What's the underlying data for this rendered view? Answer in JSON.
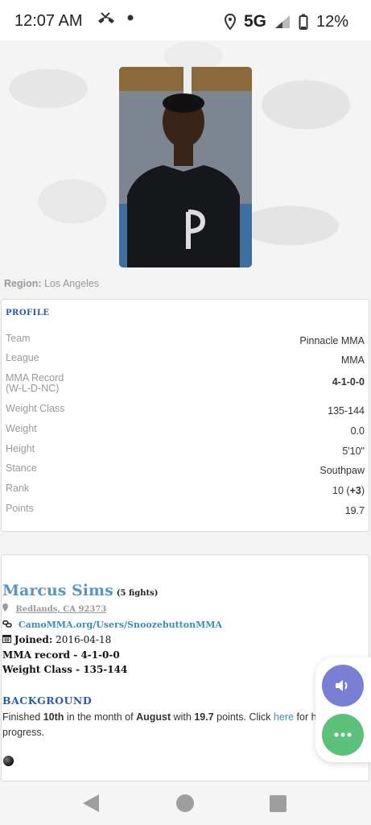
{
  "status_bar": {
    "time": "12:07 AM",
    "network": "5G",
    "battery": "12%",
    "icons": [
      "missed-call-icon",
      "dot-icon",
      "location-icon",
      "signal-icon",
      "battery-icon"
    ]
  },
  "region": {
    "label": "Region:",
    "value": "Los Angeles"
  },
  "profile": {
    "title": "PROFILE",
    "rows": [
      {
        "label": "Team",
        "value": "Pinnacle MMA"
      },
      {
        "label": "League",
        "value": "MMA"
      },
      {
        "label": "MMA Record",
        "sublabel": "(W-L-D-NC)",
        "value": "4-1-0-0"
      },
      {
        "label": "Weight Class",
        "value": "135-144"
      },
      {
        "label": "Weight",
        "value": "0.0"
      },
      {
        "label": "Height",
        "value": "5'10\""
      },
      {
        "label": "Stance",
        "value": "Southpaw"
      },
      {
        "label": "Rank",
        "value": "10",
        "change": "+3"
      },
      {
        "label": "Points",
        "value": "19.7"
      }
    ]
  },
  "bio": {
    "name": "Marcus Sims",
    "fights": "(5 fights)",
    "location": "Redlands, CA 92373",
    "url": "CamoMMA.org/Users/SnoozebuttonMMA",
    "joined_label": "Joined:",
    "joined_value": "2016-04-18",
    "record_line": "MMA record - 4-1-0-0",
    "weight_class_line": "Weight Class - 135-144",
    "background_title": "BACKGROUND",
    "bg_part1": "Finished ",
    "bg_rank": "10th",
    "bg_part2": " in the month of ",
    "bg_month": "August",
    "bg_part3": " with ",
    "bg_points": "19.7",
    "bg_part4": " points. Click ",
    "bg_link": "here",
    "bg_part5": " for his progress."
  },
  "colors": {
    "accent_blue": "#2a5ab0",
    "name_blue": "#5b95c4",
    "fab_sound": "#7a7fd6",
    "fab_more": "#5cc17b"
  }
}
